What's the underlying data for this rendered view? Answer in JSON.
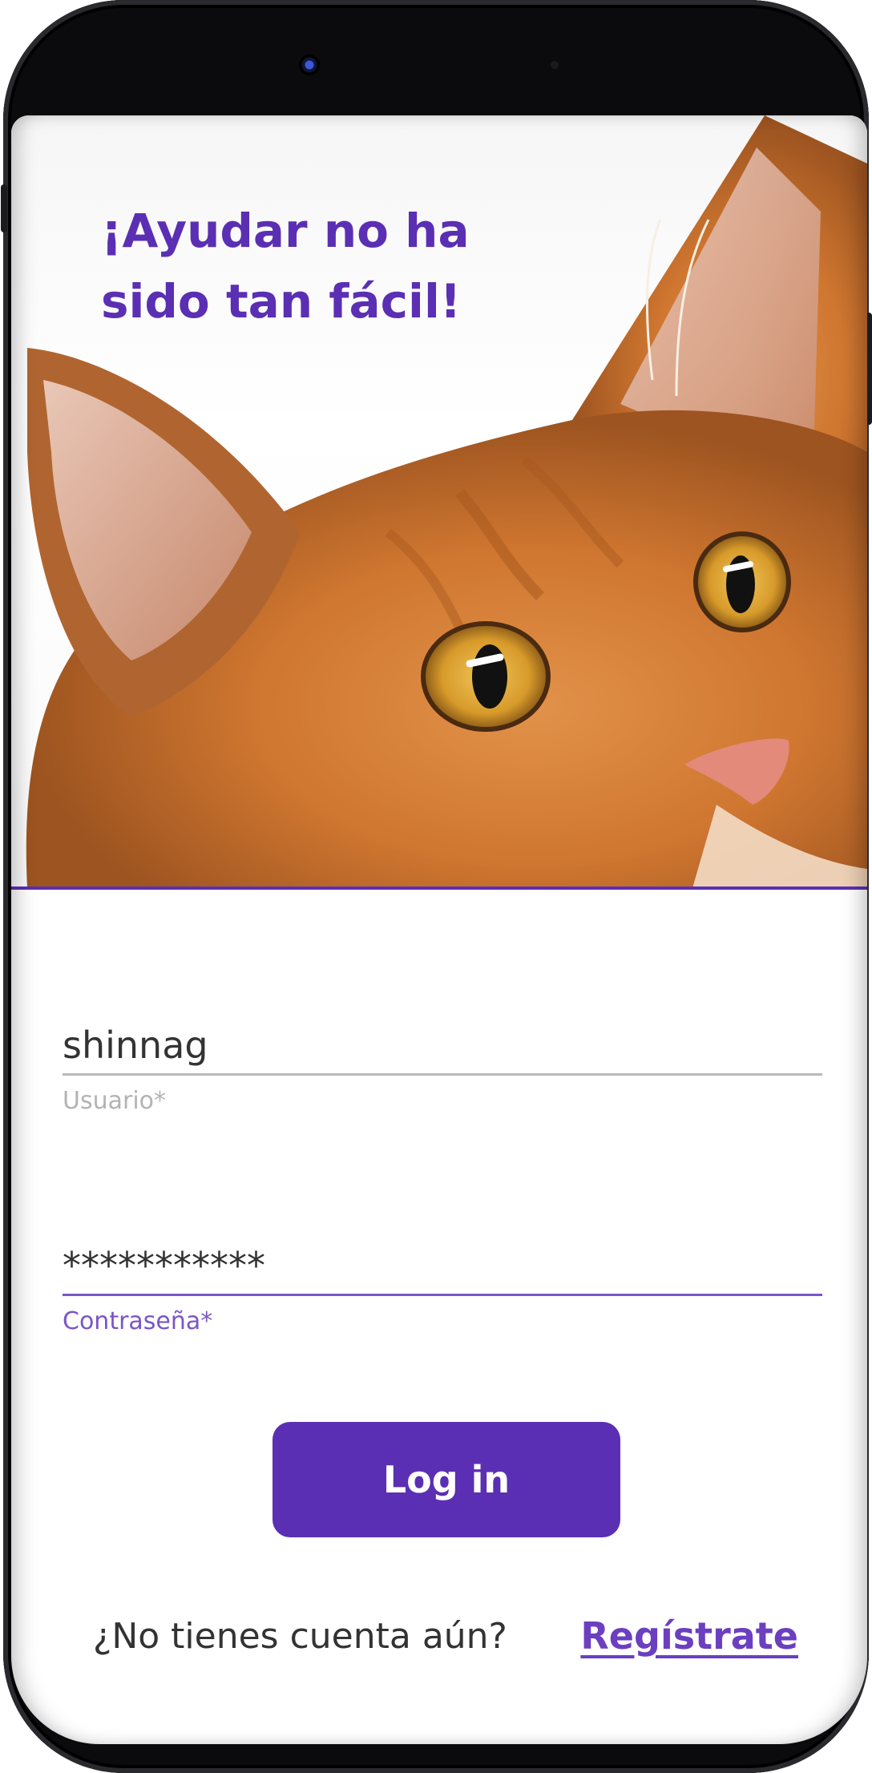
{
  "hero": {
    "title_line1": "¡Ayudar no ha",
    "title_line2": "sido tan fácil!"
  },
  "login_form": {
    "username": {
      "value": "shinnag",
      "label": "Usuario*"
    },
    "password": {
      "value": "***********",
      "label": "Contraseña*"
    },
    "login_button": "Log in"
  },
  "register": {
    "prompt": "¿No tienes cuenta aún?",
    "link": "Regístrate"
  },
  "colors": {
    "brand_purple": "#5b2fb3",
    "focus_purple": "#7a56c6",
    "text": "#333333",
    "muted": "#b3b3b3"
  },
  "icons": [
    "front-camera-icon",
    "cat-photo"
  ]
}
